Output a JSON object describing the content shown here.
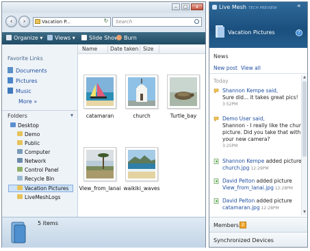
{
  "explorer": {
    "window_buttons": {
      "minimize": "–",
      "maximize": "□",
      "close": "x"
    },
    "nav": {
      "back": "‹",
      "forward": "›"
    },
    "address": "Vacation P...",
    "search_placeholder": "Search",
    "toolbar": {
      "organize": "Organize",
      "views": "Views",
      "slideshow": "Slide Show",
      "burn": "Burn"
    },
    "favorite_links_heading": "Favorite Links",
    "favorite_links": [
      {
        "label": "Documents",
        "icon": "documents-icon"
      },
      {
        "label": "Pictures",
        "icon": "pictures-icon"
      },
      {
        "label": "Music",
        "icon": "music-icon"
      }
    ],
    "more_link": "More »",
    "folders_label": "Folders",
    "folders_chevron": "▾",
    "tree": [
      {
        "label": "Desktop",
        "indent": 0
      },
      {
        "label": "Demo",
        "indent": 1
      },
      {
        "label": "Public",
        "indent": 1
      },
      {
        "label": "Computer",
        "indent": 1
      },
      {
        "label": "Network",
        "indent": 1
      },
      {
        "label": "Control Panel",
        "indent": 1
      },
      {
        "label": "Recycle Bin",
        "indent": 1
      },
      {
        "label": "Vacation Pictures",
        "indent": 1
      },
      {
        "label": "LiveMeshLogs",
        "indent": 1
      }
    ],
    "selected_tree_item": "Vacation Pictures",
    "columns": [
      "Name",
      "Date taken",
      "Size"
    ],
    "files": [
      {
        "name": "catamaran"
      },
      {
        "name": "church"
      },
      {
        "name": "Turtle_bay"
      },
      {
        "name": "View_from_lanai"
      },
      {
        "name": "waikiki_waves"
      }
    ],
    "item_count": "5 items"
  },
  "livemesh": {
    "title": "Live Mesh",
    "badge": "TECH PREVIEW",
    "collapse": "«",
    "folder_name": "Vacation Pictures",
    "help": "?",
    "news_label": "News",
    "new_post": "New post",
    "view_all": "View all",
    "today_label": "Today",
    "feed": [
      {
        "type": "comment",
        "lines": [
          "Shannon Kempe said,",
          "Sure did... it takes great pics!"
        ],
        "time": "3:52PM"
      },
      {
        "type": "comment",
        "lines": [
          "Demo User said,",
          "Shannon - I really like the church",
          "picture. Did you take that with",
          "your new camera?"
        ],
        "time": "3:25PM"
      },
      {
        "type": "file",
        "actor": "Shannon Kempe",
        "action": "added picture",
        "file": "church.jpg",
        "time": "12:29PM"
      },
      {
        "type": "file",
        "actor": "David Pelton",
        "action": "added picture",
        "file": "View_from_lanai.jpg",
        "time": "12:28PM"
      },
      {
        "type": "file",
        "actor": "David Pelton",
        "action": "added picture",
        "file": "catamaran.jpg",
        "time": "12:28PM"
      }
    ],
    "members_label": "Members",
    "members_badge": "2",
    "sync_label": "Synchronized Devices",
    "colors": {
      "header": "#1a4f7e",
      "link": "#1f4fa0",
      "accent": "#f0a830"
    }
  }
}
